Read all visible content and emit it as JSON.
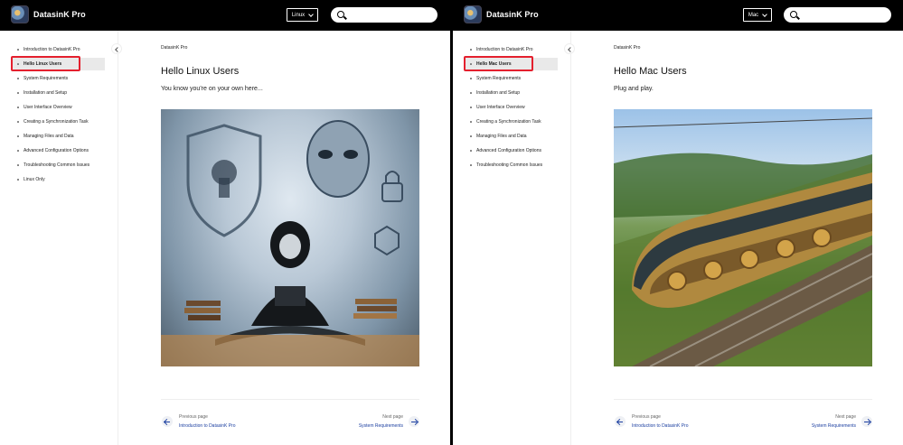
{
  "app": {
    "brand": "DatasinK Pro"
  },
  "left": {
    "os_selector": "Linux",
    "sidebar": [
      {
        "label": "Introduction to DatasinK Pro",
        "active": false
      },
      {
        "label": "Hello Linux Users",
        "active": true
      },
      {
        "label": "System Requirements",
        "active": false
      },
      {
        "label": "Installation and Setup",
        "active": false
      },
      {
        "label": "User Interface Overview",
        "active": false
      },
      {
        "label": "Creating a Synchronization Task",
        "active": false
      },
      {
        "label": "Managing Files and Data",
        "active": false
      },
      {
        "label": "Advanced Configuration Options",
        "active": false
      },
      {
        "label": "Troubleshooting Common Issues",
        "active": false
      },
      {
        "label": "Linux Only",
        "active": false
      }
    ],
    "breadcrumb": "DatasinK Pro",
    "title": "Hello Linux Users",
    "intro": "You know you're on your own here...",
    "pager": {
      "prev_small": "Previous page",
      "prev_label": "Introduction to DatasinK Pro",
      "next_small": "Next page",
      "next_label": "System Requirements"
    }
  },
  "right": {
    "os_selector": "Mac",
    "sidebar": [
      {
        "label": "Introduction to DatasinK Pro",
        "active": false
      },
      {
        "label": "Hello Mac Users",
        "active": true
      },
      {
        "label": "System Requirements",
        "active": false
      },
      {
        "label": "Installation and Setup",
        "active": false
      },
      {
        "label": "User Interface Overview",
        "active": false
      },
      {
        "label": "Creating a Synchronization Task",
        "active": false
      },
      {
        "label": "Managing Files and Data",
        "active": false
      },
      {
        "label": "Advanced Configuration Options",
        "active": false
      },
      {
        "label": "Troubleshooting Common Issues",
        "active": false
      }
    ],
    "breadcrumb": "DatasinK Pro",
    "title": "Hello Mac Users",
    "intro": "Plug and play.",
    "pager": {
      "prev_small": "Previous page",
      "prev_label": "Introduction to DatasinK Pro",
      "next_small": "Next page",
      "next_label": "System Requirements"
    }
  }
}
